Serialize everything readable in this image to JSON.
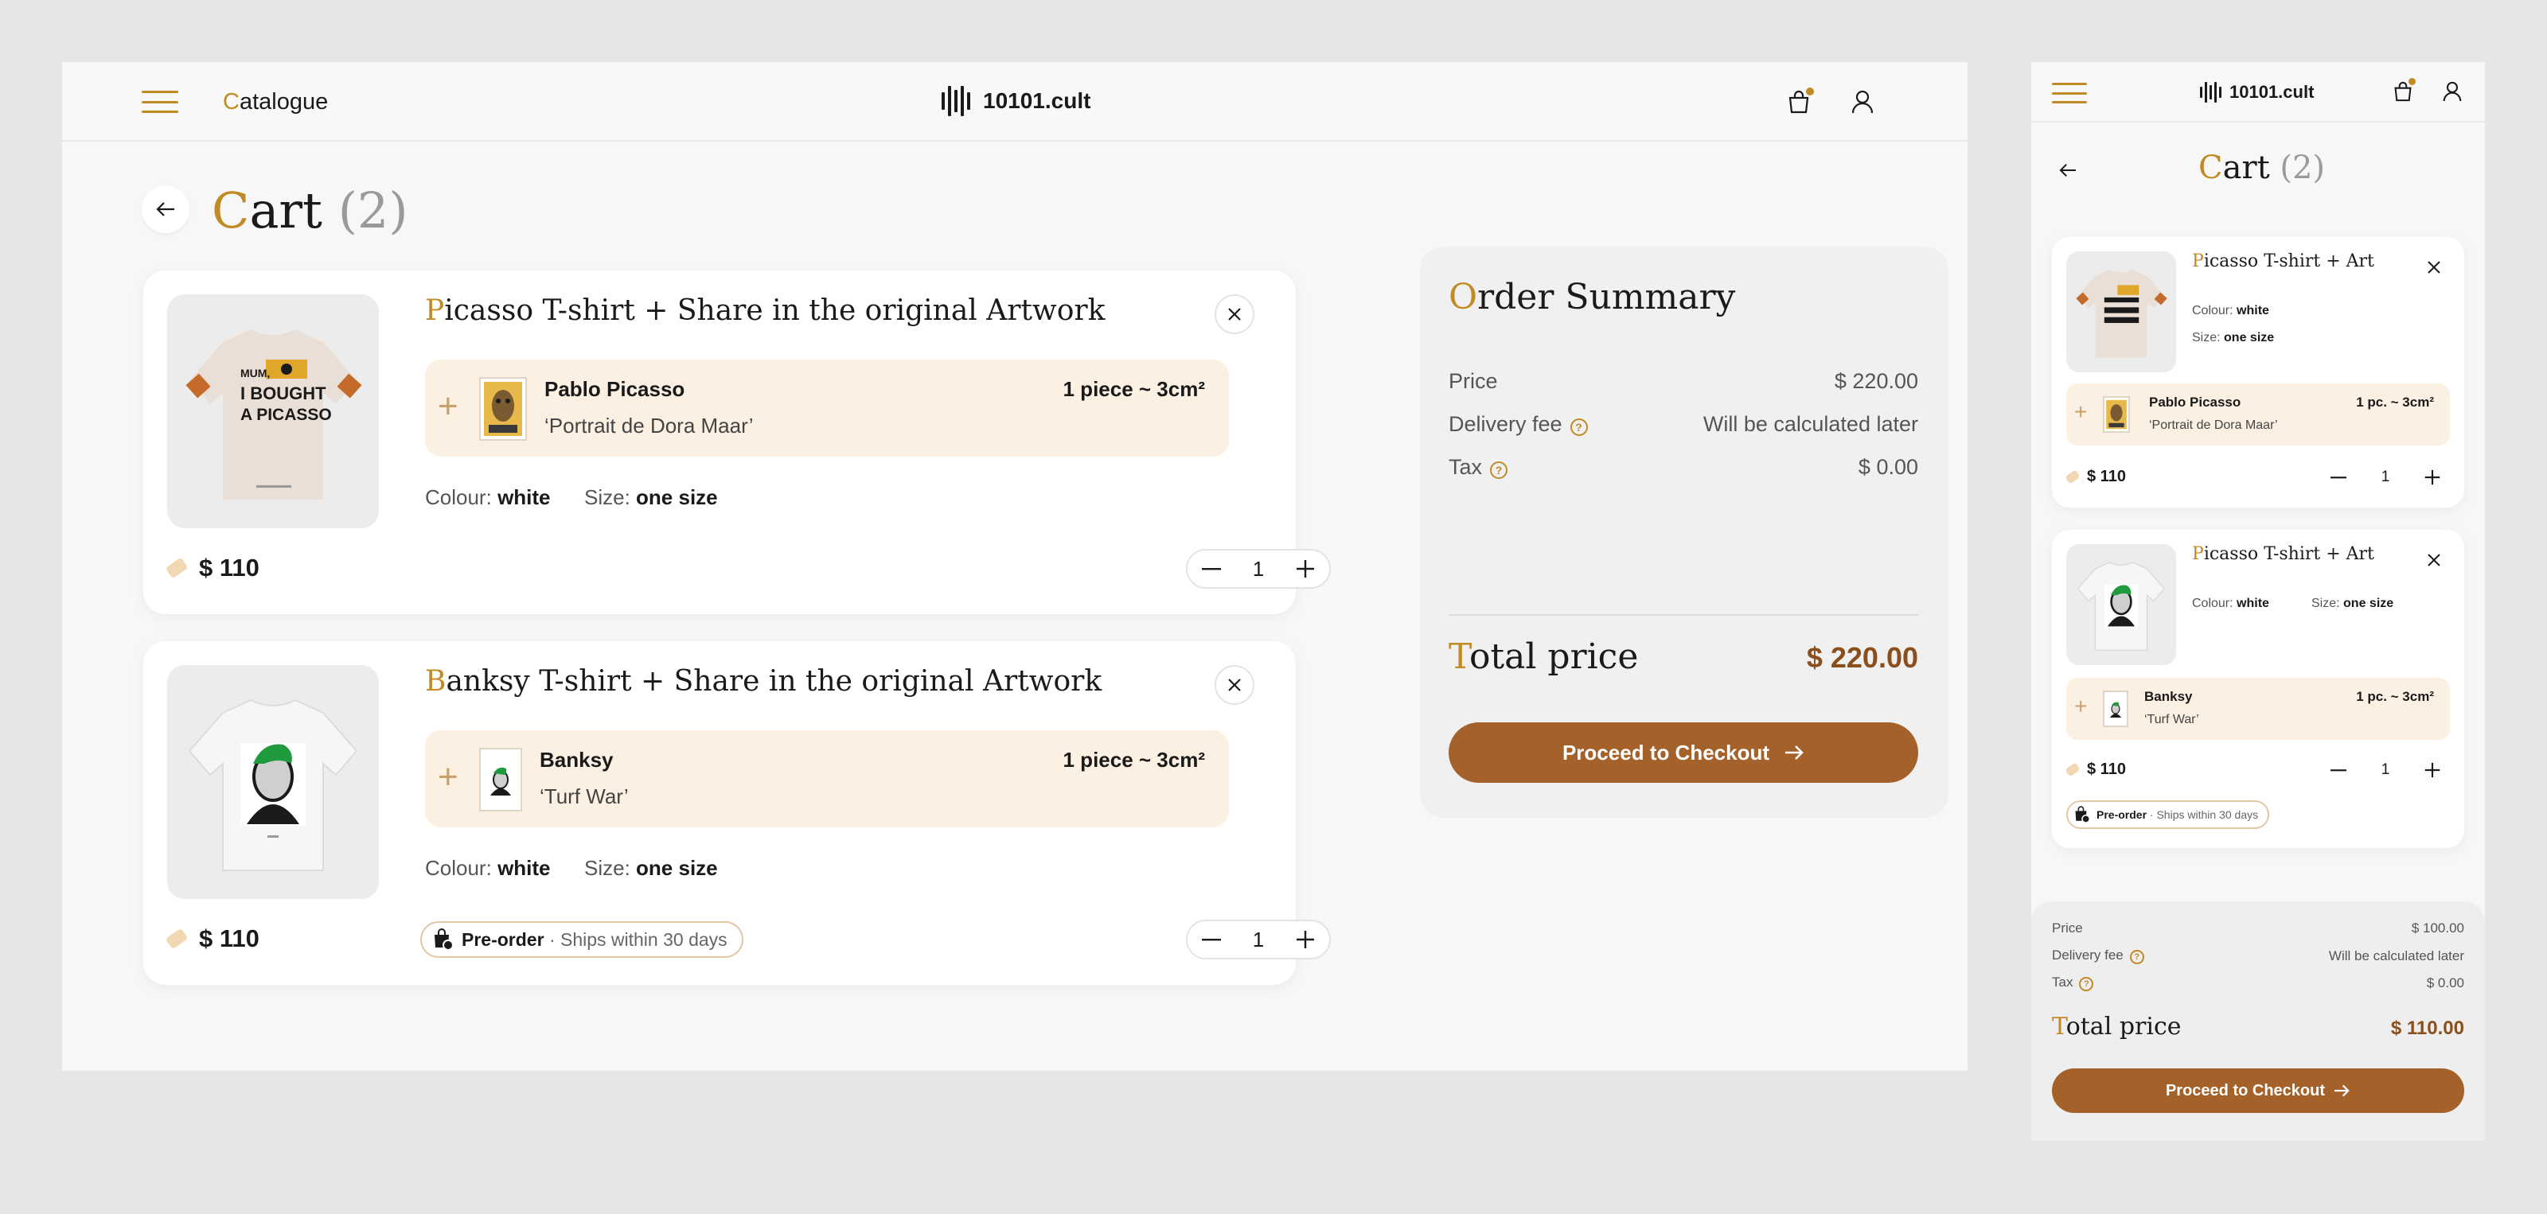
{
  "header": {
    "catalogue_label": "Catalogue",
    "brand": "10101.cult"
  },
  "cart": {
    "title": "Cart",
    "count": "(2)",
    "items": [
      {
        "title": "Picasso T-shirt + Share in the original Artwork",
        "short_title": "Picasso T-shirt + Art",
        "artist": "Pablo Picasso",
        "artwork": "‘Portrait de Dora Maar’",
        "share": "1 piece ~ 3cm²",
        "share_short": "1 pc. ~ 3cm²",
        "colour_label": "Colour:",
        "colour": "white",
        "size_label": "Size:",
        "size": "one size",
        "price": "$ 110",
        "quantity": "1",
        "shirt_text": [
          "MUM,",
          "I BOUGHT",
          "A PICASSO"
        ]
      },
      {
        "title": "Banksy T-shirt + Share in the original Artwork",
        "short_title": "Picasso T-shirt + Art",
        "artist": "Banksy",
        "artwork": "‘Turf War’",
        "share": "1 piece ~ 3cm²",
        "share_short": "1 pc. ~ 3cm²",
        "colour_label": "Colour:",
        "colour": "white",
        "size_label": "Size:",
        "size": "one size",
        "price": "$ 110",
        "quantity": "1",
        "preorder_label": "Pre-order",
        "preorder_note": "· Ships within 30 days"
      }
    ]
  },
  "summary": {
    "title": "Order Summary",
    "price_label": "Price",
    "price_value": "$ 220.00",
    "delivery_label": "Delivery fee",
    "delivery_value": "Will be calculated later",
    "tax_label": "Tax",
    "tax_value": "$ 0.00",
    "total_label": "Total price",
    "total_value": "$ 220.00",
    "checkout_label": "Proceed to Checkout"
  },
  "mobile_summary": {
    "price_value": "$ 100.00",
    "tax_value": "$ 0.00",
    "total_value": "$ 110.00"
  },
  "colors": {
    "accent": "#c08a24",
    "checkout_button": "#a4622a",
    "total_text": "#8a4f1c",
    "art_box": "#fcf0e2"
  },
  "icons": [
    "menu-icon",
    "bag-icon",
    "user-icon",
    "arrow-left-icon",
    "close-icon",
    "plus-icon",
    "minus-icon",
    "price-tag-icon",
    "arrow-right-icon",
    "question-icon",
    "shopping-bag-clock-icon"
  ]
}
